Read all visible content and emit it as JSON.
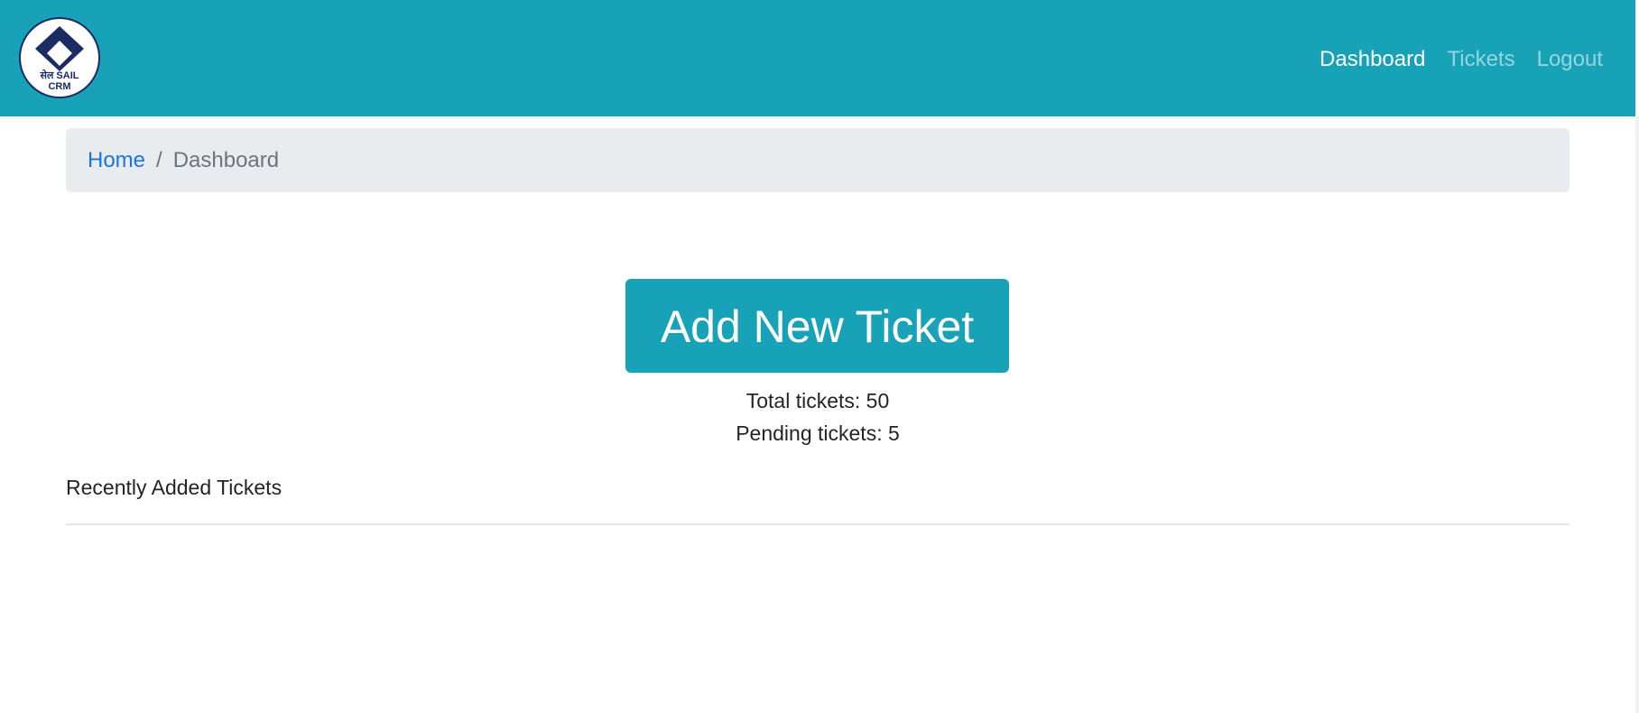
{
  "brand": {
    "logo_line1": "सेल SAIL",
    "logo_line2": "CRM"
  },
  "nav": {
    "items": [
      {
        "label": "Dashboard",
        "active": true
      },
      {
        "label": "Tickets",
        "active": false
      },
      {
        "label": "Logout",
        "active": false
      }
    ]
  },
  "breadcrumb": {
    "home": "Home",
    "separator": "/",
    "current": "Dashboard"
  },
  "main": {
    "add_button": "Add New Ticket",
    "total_tickets": "Total tickets: 50",
    "pending_tickets": "Pending tickets: 5",
    "recent_title": "Recently Added Tickets"
  },
  "colors": {
    "primary": "#17a2b8",
    "logo_navy": "#1a2c63",
    "link_blue": "#1a73e8",
    "breadcrumb_bg": "#e9ecef"
  }
}
